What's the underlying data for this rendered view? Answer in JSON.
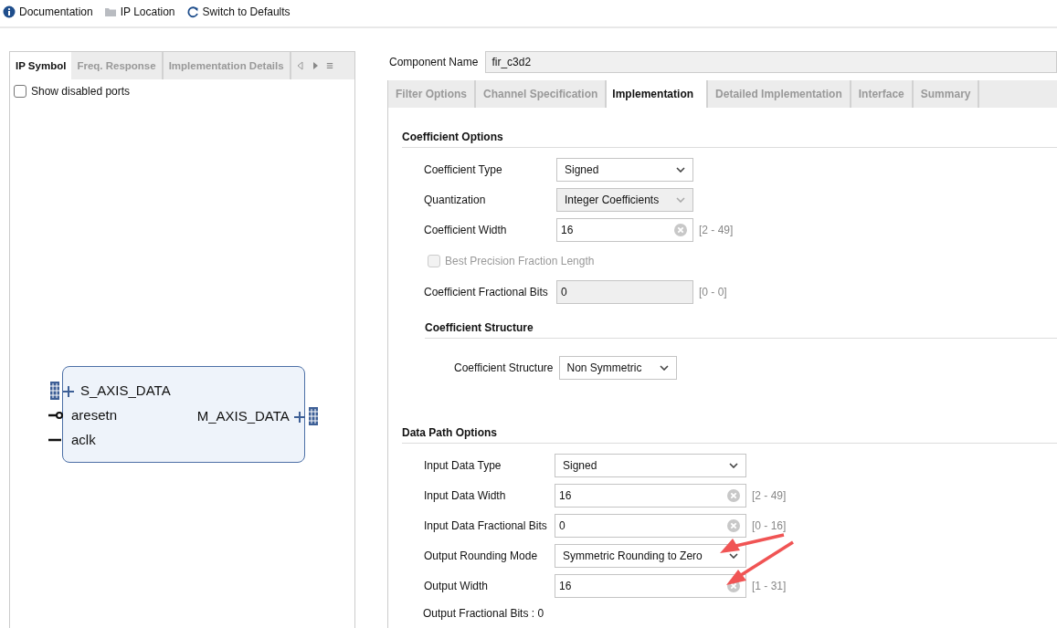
{
  "toolbar": [
    {
      "kind": "info",
      "label": "Documentation"
    },
    {
      "kind": "folder",
      "label": "IP Location"
    },
    {
      "kind": "refresh",
      "label": "Switch to Defaults"
    }
  ],
  "left_panel": {
    "tabs": [
      {
        "label": "IP Symbol",
        "selected": true
      },
      {
        "label": "Freq. Response",
        "selected": false
      },
      {
        "label": "Implementation Details",
        "selected": false
      }
    ],
    "show_disabled_ports": {
      "label": "Show disabled ports",
      "checked": false
    },
    "symbol": {
      "left_ports": [
        {
          "name": "S_AXIS_DATA",
          "kind": "bus"
        },
        {
          "name": "aresetn",
          "kind": "reset"
        },
        {
          "name": "aclk",
          "kind": "clock"
        }
      ],
      "right_ports": [
        {
          "name": "M_AXIS_DATA",
          "kind": "bus"
        }
      ]
    }
  },
  "component_name": {
    "label": "Component Name",
    "value": "fir_c3d2"
  },
  "tabs": [
    {
      "label": "Filter Options",
      "selected": false
    },
    {
      "label": "Channel Specification",
      "selected": false
    },
    {
      "label": "Implementation",
      "selected": true
    },
    {
      "label": "Detailed Implementation",
      "selected": false
    },
    {
      "label": "Interface",
      "selected": false
    },
    {
      "label": "Summary",
      "selected": false
    }
  ],
  "coefficient_options": {
    "title": "Coefficient Options",
    "fields": [
      {
        "kind": "dropdown",
        "label": "Coefficient Type",
        "value": "Signed",
        "disabled": false
      },
      {
        "kind": "dropdown",
        "label": "Quantization",
        "value": "Integer Coefficients",
        "disabled": true
      },
      {
        "kind": "input",
        "label": "Coefficient Width",
        "value": "16",
        "range": "[2 - 49]",
        "disabled": false
      },
      {
        "kind": "checkbox",
        "label": "Best Precision Fraction Length",
        "checked": false,
        "disabled": true
      },
      {
        "kind": "input",
        "label": "Coefficient Fractional Bits",
        "value": "0",
        "range": "[0 - 0]",
        "disabled": true
      }
    ],
    "structure": {
      "title": "Coefficient Structure",
      "fields": [
        {
          "kind": "dropdown",
          "label": "Coefficient Structure",
          "value": "Non Symmetric",
          "disabled": false
        }
      ]
    }
  },
  "data_path_options": {
    "title": "Data Path Options",
    "fields": [
      {
        "kind": "dropdown",
        "label": "Input Data Type",
        "value": "Signed",
        "disabled": false
      },
      {
        "kind": "input",
        "label": "Input Data Width",
        "value": "16",
        "range": "[2 - 49]",
        "disabled": false
      },
      {
        "kind": "input",
        "label": "Input Data Fractional Bits",
        "value": "0",
        "range": "[0 - 16]",
        "disabled": false
      },
      {
        "kind": "dropdown",
        "label": "Output Rounding Mode",
        "value": "Symmetric Rounding to Zero",
        "disabled": false
      },
      {
        "kind": "input",
        "label": "Output Width",
        "value": "16",
        "range": "[1 - 31]",
        "disabled": false
      }
    ],
    "note": "Output Fractional Bits : 0"
  }
}
